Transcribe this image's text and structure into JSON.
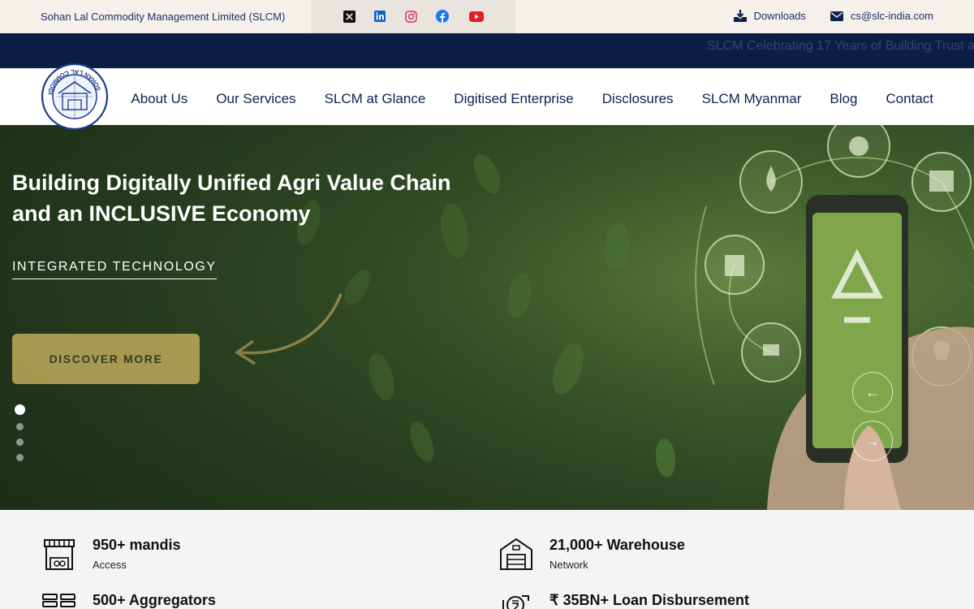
{
  "topbar": {
    "company": "Sohan Lal Commodity Management Limited (SLCM)",
    "downloads": "Downloads",
    "email": "cs@slc-india.com"
  },
  "ticker": {
    "text": "SLCM Celebrating 17 Years of Building Trust a"
  },
  "nav": {
    "logo_text": "SOHAN LAL COMMODITY",
    "items": [
      "About Us",
      "Our Services",
      "SLCM at Glance",
      "Digitised Enterprise",
      "Disclosures",
      "SLCM Myanmar",
      "Blog",
      "Contact"
    ]
  },
  "hero": {
    "title_line1": "Building Digitally Unified Agri Value Chain",
    "title_line2": "and an INCLUSIVE Economy",
    "subtitle": "INTEGRATED TECHNOLOGY",
    "cta": "DISCOVER MORE",
    "prev": "←",
    "next": "→"
  },
  "stats": [
    {
      "title": "950+ mandis",
      "desc": "Access"
    },
    {
      "title": "21,000+ Warehouse",
      "desc": "Network"
    },
    {
      "title": "500+ Aggregators",
      "desc": ""
    },
    {
      "title": "₹ 35BN+ Loan Disbursement",
      "desc": ""
    }
  ],
  "colors": {
    "navy": "#0b1f45",
    "brand_text": "#1a2f6b",
    "cta": "#bfa95a",
    "youtube": "#e02020",
    "facebook": "#1877f2",
    "instagram": "#e1306c",
    "linkedin": "#0a66c2"
  },
  "icons": [
    "x-icon",
    "linkedin-icon",
    "instagram-icon",
    "facebook-icon",
    "youtube-icon",
    "download-icon",
    "mail-icon",
    "market-stall-icon",
    "warehouse-icon",
    "aggregator-icon",
    "loan-icon"
  ]
}
